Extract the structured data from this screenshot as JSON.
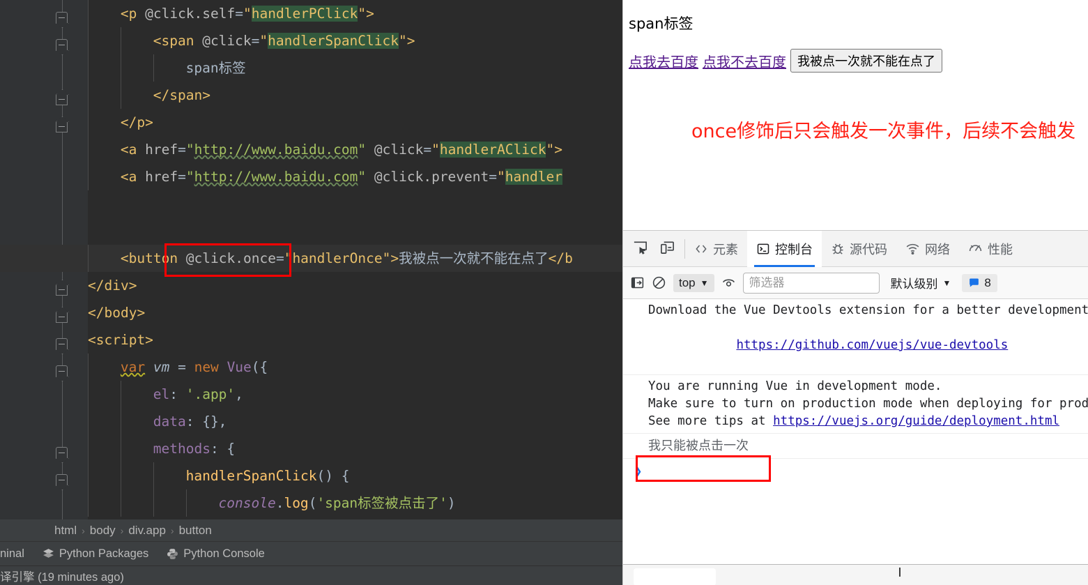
{
  "ide": {
    "code_lines": [
      {
        "indent": 4,
        "parts": [
          {
            "t": "<p ",
            "c": "tag"
          },
          {
            "t": "@click.self",
            "c": "attr"
          },
          {
            "t": "=",
            "c": "eq"
          },
          {
            "t": "\"",
            "c": "strO"
          },
          {
            "t": "handlerPClick",
            "c": "strO",
            "hl": true
          },
          {
            "t": "\"",
            "c": "strO"
          },
          {
            "t": ">",
            "c": "tag"
          }
        ]
      },
      {
        "indent": 8,
        "parts": [
          {
            "t": "<span ",
            "c": "tag"
          },
          {
            "t": "@click",
            "c": "attr"
          },
          {
            "t": "=",
            "c": "eq"
          },
          {
            "t": "\"",
            "c": "strO"
          },
          {
            "t": "handlerSpanClick",
            "c": "strO",
            "hl": true
          },
          {
            "t": "\"",
            "c": "strO"
          },
          {
            "t": ">",
            "c": "tag"
          }
        ]
      },
      {
        "indent": 12,
        "parts": [
          {
            "t": "span标签",
            "c": "text"
          }
        ]
      },
      {
        "indent": 8,
        "parts": [
          {
            "t": "</span>",
            "c": "tag"
          }
        ]
      },
      {
        "indent": 4,
        "parts": [
          {
            "t": "</p>",
            "c": "tag"
          }
        ]
      },
      {
        "indent": 4,
        "parts": [
          {
            "t": "<a ",
            "c": "tag"
          },
          {
            "t": "href",
            "c": "attr"
          },
          {
            "t": "=",
            "c": "eq"
          },
          {
            "t": "\"",
            "c": "str"
          },
          {
            "t": "http://www.baidu.com",
            "c": "str",
            "sq": true
          },
          {
            "t": "\"",
            "c": "str"
          },
          {
            "t": " ",
            "c": "text"
          },
          {
            "t": "@click",
            "c": "attr"
          },
          {
            "t": "=",
            "c": "eq"
          },
          {
            "t": "\"",
            "c": "strO"
          },
          {
            "t": "handlerAClick",
            "c": "strO",
            "hl": true
          },
          {
            "t": "\"",
            "c": "strO"
          },
          {
            "t": ">",
            "c": "tag"
          }
        ]
      },
      {
        "indent": 4,
        "parts": [
          {
            "t": "<a ",
            "c": "tag"
          },
          {
            "t": "href",
            "c": "attr"
          },
          {
            "t": "=",
            "c": "eq"
          },
          {
            "t": "\"",
            "c": "str"
          },
          {
            "t": "http://www.baidu.com",
            "c": "str",
            "sq": true
          },
          {
            "t": "\"",
            "c": "str"
          },
          {
            "t": " ",
            "c": "text"
          },
          {
            "t": "@click.prevent",
            "c": "attr"
          },
          {
            "t": "=",
            "c": "eq"
          },
          {
            "t": "\"",
            "c": "strO"
          },
          {
            "t": "handler",
            "c": "strO",
            "hl": true
          }
        ]
      },
      {
        "indent": 0,
        "parts": []
      },
      {
        "indent": 0,
        "parts": []
      },
      {
        "indent": 4,
        "current": true,
        "parts": [
          {
            "t": "<button ",
            "c": "tag"
          },
          {
            "t": "@click.once",
            "c": "attr"
          },
          {
            "t": "=",
            "c": "eq"
          },
          {
            "t": "\"",
            "c": "strO"
          },
          {
            "t": "handlerOnce",
            "c": "strO"
          },
          {
            "t": "\"",
            "c": "strO"
          },
          {
            "t": ">",
            "c": "tag"
          },
          {
            "t": "我被点一次就不能在点了",
            "c": "text"
          },
          {
            "t": "</b",
            "c": "tag"
          }
        ]
      },
      {
        "indent": 0,
        "parts": [
          {
            "t": "</div>",
            "c": "tag"
          }
        ]
      },
      {
        "indent": 0,
        "parts": [
          {
            "t": "</body>",
            "c": "tag"
          }
        ]
      },
      {
        "indent": 0,
        "parts": [
          {
            "t": "<script>",
            "c": "tag"
          }
        ]
      },
      {
        "indent": 4,
        "parts": [
          {
            "t": "var",
            "c": "kw",
            "sqw": true
          },
          {
            "t": " ",
            "c": "text"
          },
          {
            "t": "vm",
            "c": "var"
          },
          {
            "t": " = ",
            "c": "punct"
          },
          {
            "t": "new",
            "c": "kw"
          },
          {
            "t": " ",
            "c": "text"
          },
          {
            "t": "Vue",
            "c": "cls"
          },
          {
            "t": "({",
            "c": "punct"
          }
        ]
      },
      {
        "indent": 8,
        "parts": [
          {
            "t": "el",
            "c": "prop"
          },
          {
            "t": ": ",
            "c": "punct"
          },
          {
            "t": "'.app'",
            "c": "str"
          },
          {
            "t": ",",
            "c": "punct"
          }
        ]
      },
      {
        "indent": 8,
        "parts": [
          {
            "t": "data",
            "c": "prop"
          },
          {
            "t": ": {},",
            "c": "punct"
          }
        ]
      },
      {
        "indent": 8,
        "parts": [
          {
            "t": "methods",
            "c": "prop"
          },
          {
            "t": ": {",
            "c": "punct"
          }
        ]
      },
      {
        "indent": 12,
        "parts": [
          {
            "t": "handlerSpanClick",
            "c": "fn"
          },
          {
            "t": "() {",
            "c": "punct"
          }
        ]
      },
      {
        "indent": 16,
        "parts": [
          {
            "t": "console",
            "c": "obj"
          },
          {
            "t": ".",
            "c": "punct"
          },
          {
            "t": "log",
            "c": "fn"
          },
          {
            "t": "(",
            "c": "punct"
          },
          {
            "t": "'span标签被点击了'",
            "c": "str"
          },
          {
            "t": ")",
            "c": "punct"
          }
        ]
      }
    ],
    "breadcrumb": [
      "html",
      "body",
      "div.app",
      "button"
    ],
    "toolwindow_items": [
      "ninal",
      "Python Packages",
      "Python Console"
    ],
    "status_text": "译引擎 (19 minutes ago)",
    "accent_annotation_color": "#ff0000"
  },
  "browser": {
    "page": {
      "span_label": "span标签",
      "link1": "点我去百度",
      "link2": "点我不去百度",
      "button_label": "我被点一次就不能在点了",
      "note": "once修饰后只会触发一次事件，后续不会触发",
      "note_color": "#ff2116",
      "link_color": "#551a8b"
    },
    "devtools": {
      "icons": [
        "inspect-element-icon",
        "device-toolbar-icon"
      ],
      "tabs": [
        {
          "label": "元素",
          "icon": "code-brackets-icon",
          "active": false
        },
        {
          "label": "控制台",
          "icon": "console-terminal-icon",
          "active": true
        },
        {
          "label": "源代码",
          "icon": "bug-icon",
          "active": false
        },
        {
          "label": "网络",
          "icon": "wifi-icon",
          "active": false
        },
        {
          "label": "性能",
          "icon": "gauge-icon",
          "active": false
        }
      ],
      "active_tab_underline_color": "#1a73e8",
      "toolbar": {
        "sidebar_toggle_icon": "show-sidebar-icon",
        "clear_icon": "clear-console-icon",
        "context": "top",
        "eye_icon": "live-expression-icon",
        "filter_placeholder": "筛选器",
        "filter_value": "",
        "level": "默认级别",
        "message_count": "8",
        "message_badge_icon": "message-bubble-icon"
      },
      "console": {
        "groups": [
          {
            "lines": [
              {
                "text": "Download the Vue Devtools extension for a better development ",
                "link": false
              },
              {
                "text": "https://github.com/vuejs/vue-devtools",
                "link": true
              }
            ]
          },
          {
            "lines": [
              {
                "text": "You are running Vue in development mode.",
                "link": false
              },
              {
                "text": "Make sure to turn on production mode when deploying for produ",
                "link": false
              },
              {
                "text": "See more tips at ",
                "link": false,
                "suffix": "https://vuejs.org/guide/deployment.html"
              }
            ]
          }
        ],
        "output": "我只能被点击一次",
        "prompt": "❯"
      }
    }
  }
}
